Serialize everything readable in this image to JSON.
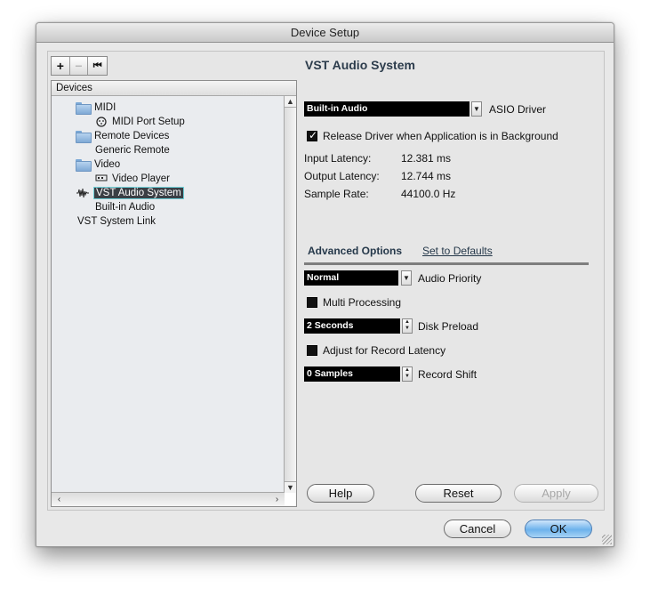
{
  "window": {
    "title": "Device Setup"
  },
  "toolbar": {
    "add_label": "+",
    "remove_label": "−",
    "reset_label": "⏮"
  },
  "tree": {
    "header": "Devices",
    "items": [
      {
        "label": "MIDI",
        "level": 0,
        "icon": "folder-icon"
      },
      {
        "label": "MIDI Port Setup",
        "level": 1,
        "icon": "midi-port-icon"
      },
      {
        "label": "Remote Devices",
        "level": 0,
        "icon": "folder-icon"
      },
      {
        "label": "Generic Remote",
        "level": 1,
        "icon": ""
      },
      {
        "label": "Video",
        "level": 0,
        "icon": "folder-icon"
      },
      {
        "label": "Video Player",
        "level": 1,
        "icon": "video-player-icon"
      },
      {
        "label": "VST Audio System",
        "level": 0,
        "icon": "vst-audio-icon",
        "selected": true
      },
      {
        "label": "Built-in Audio",
        "level": 1,
        "icon": ""
      },
      {
        "label": "VST System Link",
        "level": 0,
        "icon": ""
      }
    ]
  },
  "panel": {
    "title": "VST Audio System",
    "driver": {
      "value": "Built-in Audio",
      "label": "ASIO Driver"
    },
    "release_driver": {
      "label": "Release Driver when Application is in Background",
      "checked": true
    },
    "stats": [
      {
        "label": "Input Latency:",
        "value": "12.381 ms"
      },
      {
        "label": "Output Latency:",
        "value": "12.744 ms"
      },
      {
        "label": "Sample Rate:",
        "value": "44100.0 Hz"
      }
    ],
    "tabs": {
      "advanced": "Advanced Options",
      "defaults": "Set to Defaults"
    },
    "audio_priority": {
      "value": "Normal",
      "label": "Audio Priority"
    },
    "multi_processing": {
      "label": "Multi Processing",
      "checked": false
    },
    "disk_preload": {
      "value": "2 Seconds",
      "label": "Disk Preload"
    },
    "record_latency": {
      "label": "Adjust for Record Latency",
      "checked": false
    },
    "record_shift": {
      "value": "0 Samples",
      "label": "Record Shift"
    }
  },
  "buttons": {
    "help": "Help",
    "reset": "Reset",
    "apply": "Apply",
    "cancel": "Cancel",
    "ok": "OK"
  }
}
